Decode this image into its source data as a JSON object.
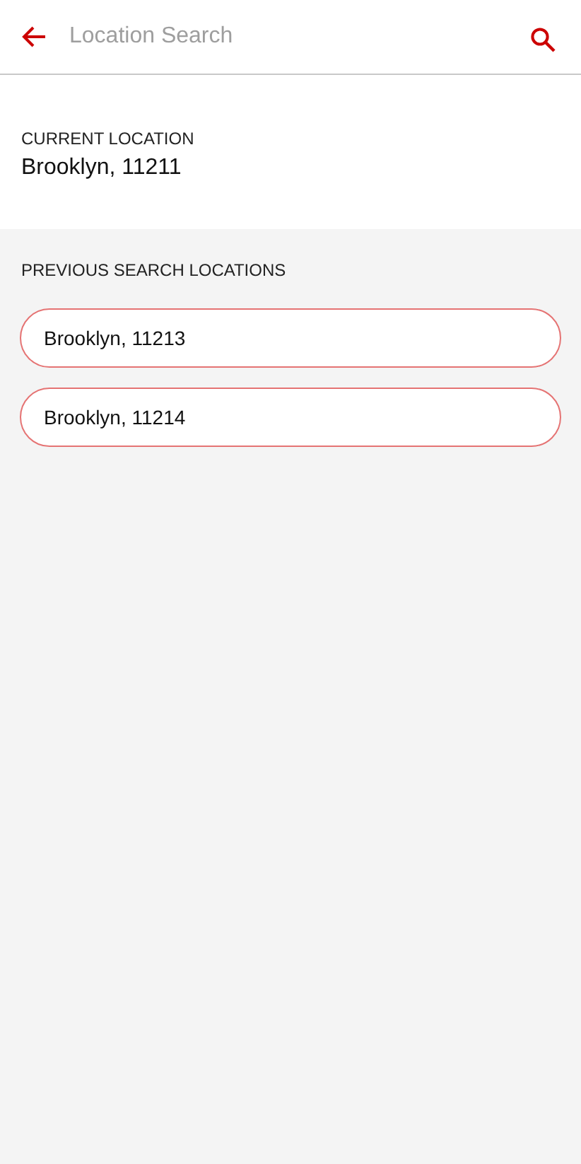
{
  "search": {
    "placeholder": "Location Search"
  },
  "current_location": {
    "label": "CURRENT LOCATION",
    "value": "Brooklyn, 11211"
  },
  "previous": {
    "label": "PREVIOUS SEARCH LOCATIONS",
    "items": [
      {
        "text": "Brooklyn, 11213"
      },
      {
        "text": "Brooklyn, 11214"
      }
    ]
  }
}
